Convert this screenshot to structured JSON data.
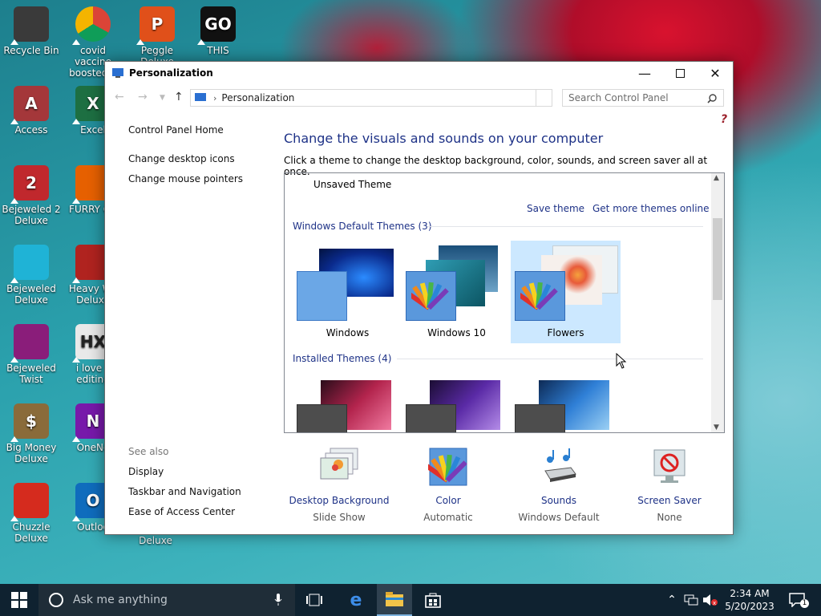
{
  "desktop_icons": [
    {
      "label": "Recycle Bin",
      "icon": "recycle-bin-icon",
      "color": "#3a3a3a",
      "glyph": ""
    },
    {
      "label": "covid vaccine boosted h",
      "icon": "chrome-icon",
      "color": "#e33b2e",
      "glyph": ""
    },
    {
      "label": "Peggle Deluxe",
      "icon": "peggle-icon",
      "color": "#e0501a",
      "glyph": "P"
    },
    {
      "label": "THIS",
      "icon": "goland-icon",
      "color": "#111111",
      "glyph": "GO"
    },
    {
      "label": "Access",
      "icon": "access-icon",
      "color": "#a4373a",
      "glyph": "A"
    },
    {
      "label": "Excel",
      "icon": "excel-icon",
      "color": "#1d6f42",
      "glyph": "X"
    },
    {
      "label": "Bejeweled 2 Deluxe",
      "icon": "bejeweled2-icon",
      "color": "#c0282d",
      "glyph": "2"
    },
    {
      "label": "FURRY CU",
      "icon": "firefox-icon",
      "color": "#e66000",
      "glyph": ""
    },
    {
      "label": "Bejeweled Deluxe",
      "icon": "bejeweled-icon",
      "color": "#1fb3d6",
      "glyph": ""
    },
    {
      "label": "Heavy We Deluxe",
      "icon": "heavy-weapon-icon",
      "color": "#b0231f",
      "glyph": ""
    },
    {
      "label": "Bejeweled Twist",
      "icon": "bejeweled-twist-icon",
      "color": "#8a1d7a",
      "glyph": ""
    },
    {
      "label": "i love s editing",
      "icon": "hxd-icon",
      "color": "#e9e9e9",
      "glyph": "HX"
    },
    {
      "label": "Big Money Deluxe",
      "icon": "big-money-icon",
      "color": "#8a6b3a",
      "glyph": "$"
    },
    {
      "label": "OneNo",
      "icon": "onenote-icon",
      "color": "#7719aa",
      "glyph": "N"
    },
    {
      "label": "Chuzzle Deluxe",
      "icon": "chuzzle-icon",
      "color": "#d52b1e",
      "glyph": ""
    },
    {
      "label": "Outloo",
      "icon": "outlook-icon",
      "color": "#0f6cbd",
      "glyph": "O"
    }
  ],
  "stray_label": "Deluxe",
  "window": {
    "title": "Personalization",
    "address": "Personalization",
    "search_placeholder": "Search Control Panel",
    "help": "?"
  },
  "left_nav": {
    "home": "Control Panel Home",
    "links": [
      "Change desktop icons",
      "Change mouse pointers"
    ],
    "see_also": "See also",
    "see_also_links": [
      "Display",
      "Taskbar and Navigation",
      "Ease of Access Center"
    ]
  },
  "main": {
    "title": "Change the visuals and sounds on your computer",
    "subtitle": "Click a theme to change the desktop background, color, sounds, and screen saver all at once.",
    "unsaved": "Unsaved Theme",
    "save_theme": "Save theme",
    "get_more": "Get more themes online",
    "default_section": "Windows Default Themes (3)",
    "installed_section": "Installed Themes (4)",
    "themes": [
      "Windows",
      "Windows 10",
      "Flowers"
    ],
    "selected_theme": "Flowers"
  },
  "bottom": [
    {
      "label": "Desktop Background",
      "value": "Slide Show",
      "icon": "desktop-background-icon"
    },
    {
      "label": "Color",
      "value": "Automatic",
      "icon": "color-icon"
    },
    {
      "label": "Sounds",
      "value": "Windows Default",
      "icon": "sounds-icon"
    },
    {
      "label": "Screen Saver",
      "value": "None",
      "icon": "screen-saver-icon"
    }
  ],
  "taskbar": {
    "search_placeholder": "Ask me anything",
    "time": "2:34 AM",
    "date": "5/20/2023",
    "notification_count": "1"
  }
}
